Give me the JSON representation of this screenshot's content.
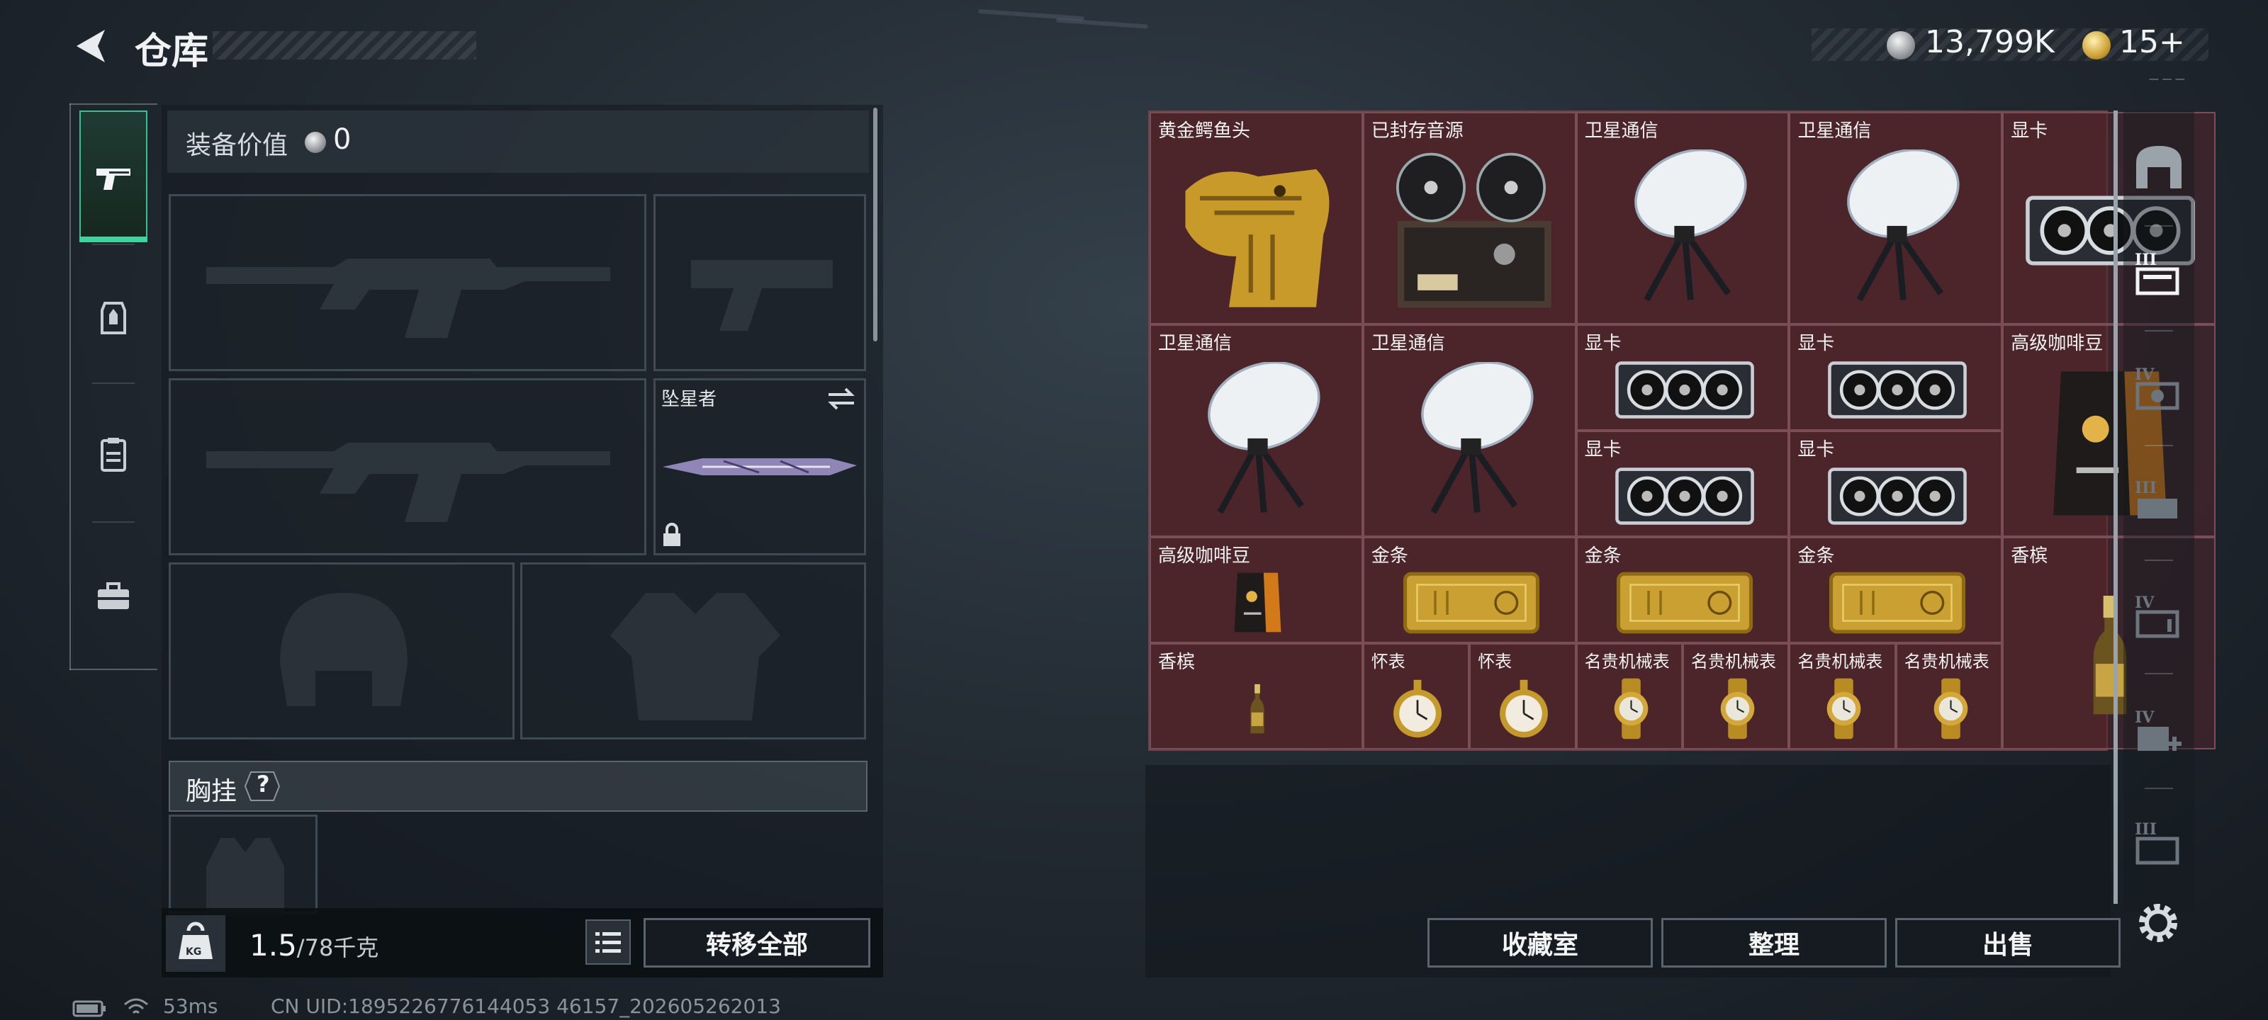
{
  "header": {
    "title": "仓库",
    "back_icon": "back-arrow-icon"
  },
  "currency": {
    "silver": "13,799K",
    "gold": "15+",
    "corner_label": "— — —"
  },
  "left_tabs": [
    {
      "name": "weapon-tab",
      "icon": "pistol-icon",
      "active": true
    },
    {
      "name": "gear-tab",
      "icon": "backpack-armor-icon",
      "active": false
    },
    {
      "name": "container-tab",
      "icon": "clipboard-icon",
      "active": false
    },
    {
      "name": "toolbox-tab",
      "icon": "toolbox-icon",
      "active": false
    }
  ],
  "equipment": {
    "value_label": "装备价值",
    "value": "0",
    "melee_label": "坠星者",
    "chest_rig_label": "胸挂",
    "help_mark": "?"
  },
  "weight": {
    "current": "1.5",
    "capacity": "/78千克",
    "unit_icon": "KG"
  },
  "buttons": {
    "transfer_all": "转移全部",
    "collection": "收藏室",
    "organize": "整理",
    "sell": "出售"
  },
  "storage_items": [
    {
      "label": "黄金鳄鱼头",
      "icon": "golden-crocodile-head-icon"
    },
    {
      "label": "已封存音源",
      "icon": "reel-to-reel-recorder-icon"
    },
    {
      "label": "卫星通信",
      "icon": "satellite-dish-icon"
    },
    {
      "label": "卫星通信",
      "icon": "satellite-dish-icon"
    },
    {
      "label": "显卡",
      "icon": "graphics-card-icon"
    },
    {
      "label": "卫星通信",
      "icon": "satellite-dish-icon"
    },
    {
      "label": "卫星通信",
      "icon": "satellite-dish-icon"
    },
    {
      "label": "显卡",
      "icon": "graphics-card-icon"
    },
    {
      "label": "显卡",
      "icon": "graphics-card-icon"
    },
    {
      "label": "高级咖啡豆",
      "icon": "coffee-bag-icon"
    },
    {
      "label": "显卡",
      "icon": "graphics-card-icon"
    },
    {
      "label": "显卡",
      "icon": "graphics-card-icon"
    },
    {
      "label": "高级咖啡豆",
      "icon": "coffee-bag-icon"
    },
    {
      "label": "金条",
      "icon": "gold-bar-icon"
    },
    {
      "label": "金条",
      "icon": "gold-bar-icon"
    },
    {
      "label": "金条",
      "icon": "gold-bar-icon"
    },
    {
      "label": "香槟",
      "icon": "champagne-bottle-icon"
    },
    {
      "label": "香槟",
      "icon": "champagne-bottle-icon"
    },
    {
      "label": "怀表",
      "icon": "pocket-watch-icon"
    },
    {
      "label": "怀表",
      "icon": "pocket-watch-icon"
    },
    {
      "label": "名贵机械表",
      "icon": "luxury-watch-icon"
    },
    {
      "label": "名贵机械表",
      "icon": "luxury-watch-icon"
    },
    {
      "label": "名贵机械表",
      "icon": "luxury-watch-icon"
    },
    {
      "label": "名贵机械表",
      "icon": "luxury-watch-icon"
    }
  ],
  "right_tabs": [
    {
      "icon": "garage-icon",
      "tier": ""
    },
    {
      "icon": "storage-extension-icon",
      "tier": "III"
    },
    {
      "icon": "storage-extension-icon",
      "tier": "IV"
    },
    {
      "icon": "storage-extension-icon",
      "tier": "III"
    },
    {
      "icon": "storage-extension-icon",
      "tier": "IV"
    },
    {
      "icon": "storage-extension-icon",
      "tier": "IV"
    },
    {
      "icon": "storage-extension-icon",
      "tier": "III"
    }
  ],
  "status": {
    "ping": "53ms",
    "uid": "CN UID:1895226776144053 46157_202605262013"
  },
  "colors": {
    "accent_green": "#3fd39e",
    "cell_bg": "#54262e",
    "gold": "#c89a2c"
  }
}
